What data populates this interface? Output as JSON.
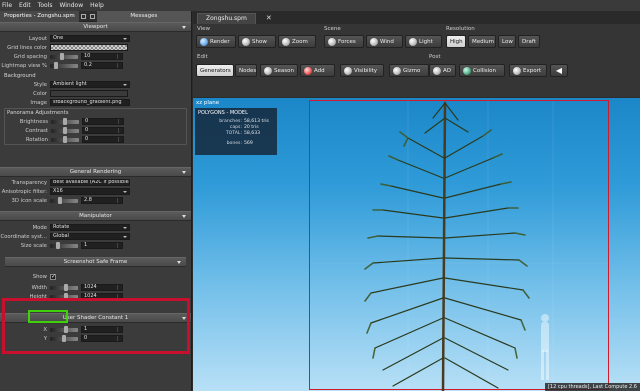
{
  "menubar": {
    "items": [
      "File",
      "Edit",
      "Tools",
      "Window",
      "Help"
    ]
  },
  "left_panel": {
    "tabs": {
      "properties": "Properties - Zongshu.spm",
      "messages": "Messages"
    },
    "viewport": {
      "header": "Viewport",
      "layout_label": "Layout",
      "layout_value": "One",
      "grid_lines_color_label": "Grid lines color",
      "grid_spacing_label": "Grid spacing",
      "grid_spacing_value": "10",
      "lightmap_view_label": "Lightmap view %",
      "lightmap_view_value": "0.2",
      "background_title": "Background",
      "style_label": "Style",
      "style_value": "Ambient light",
      "color_label": "Color",
      "image_label": "Image",
      "image_value": "sfbackground_gradient.png",
      "panorama_title": "Panorama Adjustments",
      "brightness_label": "Brightness",
      "brightness_value": "0",
      "contrast_label": "Contrast",
      "contrast_value": "0",
      "rotation_label": "Rotation",
      "rotation_value": "0"
    },
    "general_rendering": {
      "header": "General Rendering",
      "transparency_label": "Transparency",
      "transparency_value": "Best available (A2C if possible",
      "anisotropic_label": "Anisotropic filter:",
      "anisotropic_value": "X16",
      "icon_scale_label": "3D icon scale",
      "icon_scale_value": "2.8"
    },
    "manipulator": {
      "header": "Manipulator",
      "mode_label": "Mode",
      "mode_value": "Rotate",
      "coord_label": "Coordinate syst...",
      "coord_value": "Global",
      "size_label": "Size scale",
      "size_value": "1"
    },
    "screenshot_safe_frame": {
      "header": "Screenshot Safe Frame",
      "show_label": "Show",
      "show_checked": true,
      "width_label": "Width",
      "width_value": "1024",
      "height_label": "Height",
      "height_value": "1024"
    },
    "user_shader": {
      "header": "User Shader Constant 1",
      "x_label": "X",
      "x_value": "1",
      "y_label": "Y",
      "y_value": "0"
    }
  },
  "document_tab": {
    "label": "Zongshu.spm"
  },
  "toolbar": {
    "view_label": "View",
    "render": "Render",
    "show": "Show",
    "zoom": "Zoom",
    "scene_label": "Scene",
    "forces": "Forces",
    "wind": "Wind",
    "light": "Light",
    "resolution_label": "Resolution",
    "high": "High",
    "medium": "Medium",
    "low": "Low",
    "draft": "Draft",
    "edit_label": "Edit",
    "generators": "Generators",
    "nodes": "Nodes",
    "season": "Season",
    "add": "Add",
    "visibility": "Visibility",
    "gizmo": "Gizmo",
    "post_label": "Post",
    "ao": "AO",
    "collision": "Collision",
    "export": "Export"
  },
  "viewport_view": {
    "plane_label": "xz plane",
    "stats_title": "POLYGONS - MODEL",
    "branches_label": "branches:",
    "branches_value": "58,613 tris",
    "caps_label": "caps:",
    "caps_value": "20 tris",
    "total_label": "TOTAL:",
    "total_value": "58,633",
    "bones_label": "bones:",
    "bones_value": "569",
    "status": "[12 cpu threads], Last Compute 2.6"
  },
  "colors": {
    "safe_frame": "#d21b2a",
    "highlight_frame_red": "#c8102e",
    "highlight_frame_green": "#3ed10a"
  }
}
